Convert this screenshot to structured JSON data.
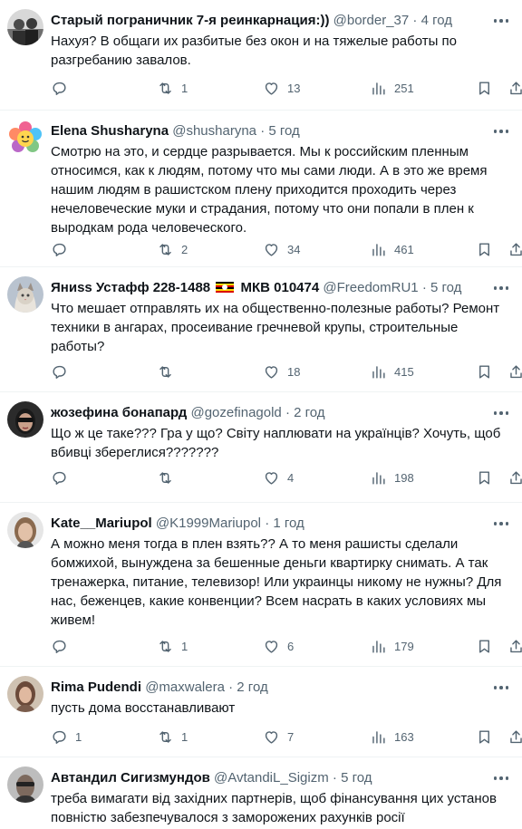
{
  "tweets": [
    {
      "name": "Старый пограничник 7-я реинкарнация:))",
      "handle": "@border_37",
      "time": "4 год",
      "lines": [
        "Нахуя? В общаги их разбитые без окон и на тяжелые работы по",
        "разгребанию завалов."
      ],
      "retweets": "1",
      "likes": "13",
      "views": "251",
      "replies": ""
    },
    {
      "name": "Elena Shusharyna",
      "handle": "@shusharyna",
      "time": "5 год",
      "lines": [
        "Смотрю на это, и сердце разрывается. Мы к российским пленным",
        "относимся, как к людям, потому что мы сами люди. А в это же время",
        "нашим людям в рашистском плену приходится проходить через",
        "нечеловеческие муки и страдания, потому что они попали в плен к",
        "выродкам рода человеческого."
      ],
      "retweets": "2",
      "likes": "34",
      "views": "461",
      "replies": ""
    },
    {
      "name": "Яниss Устафф 228-1488",
      "name2": "МКВ 010474",
      "handle": "@FreedomRU1",
      "time": "5 год",
      "lines": [
        "Что мешает отправлять их на общественно-полезные работы? Ремонт",
        "техники в ангарах, просеивание гречневой крупы, строительные",
        "работы?"
      ],
      "retweets": "",
      "likes": "18",
      "views": "415",
      "replies": ""
    },
    {
      "name": "жозефина бонапард",
      "handle": "@gozefinagold",
      "time": "2 год",
      "lines": [
        "Що ж це таке??? Гра у що? Світу наплювати на українців? Хочуть, щоб",
        "вбивці збереглися???????"
      ],
      "retweets": "",
      "likes": "4",
      "views": "198",
      "replies": ""
    },
    {
      "name": "Kate__Mariupol",
      "handle": "@K1999Mariupol",
      "time": "1 год",
      "lines": [
        "А можно меня тогда в плен взять?? А то меня рашисты сделали",
        "бомжихой, вынуждена за бешенные деньги квартирку снимать. А так",
        "тренажерка, питание, телевизор!  Или украинцы никому не нужны? Для",
        "нас, беженцев, какие конвенции? Всем насрать в каких условиях мы",
        "живем!"
      ],
      "retweets": "1",
      "likes": "6",
      "views": "179",
      "replies": ""
    },
    {
      "name": "Rima Pudendi",
      "handle": "@maxwalera",
      "time": "2 год",
      "lines": [
        "пусть дома восстанавливают"
      ],
      "retweets": "1",
      "likes": "7",
      "views": "163",
      "replies": "1"
    },
    {
      "name": "Автандил Сигизмундов",
      "handle": "@AvtandiL_Sigizm",
      "time": "5 год",
      "lines": [
        "треба вимагати від західних партнерів, щоб фінансування цих установ",
        "повністю забезпечувалося з заморожених рахунків росії"
      ],
      "retweets": "",
      "likes": "",
      "views": "",
      "replies": ""
    }
  ],
  "icons": {
    "reply": "reply-icon",
    "retweet": "retweet-icon",
    "like": "heart-icon",
    "views": "views-icon",
    "bookmark": "bookmark-icon",
    "share": "share-icon",
    "more": "more-icon"
  },
  "colors": {
    "text": "#0f1419",
    "secondary": "#536471",
    "divider": "#eff3f4"
  }
}
